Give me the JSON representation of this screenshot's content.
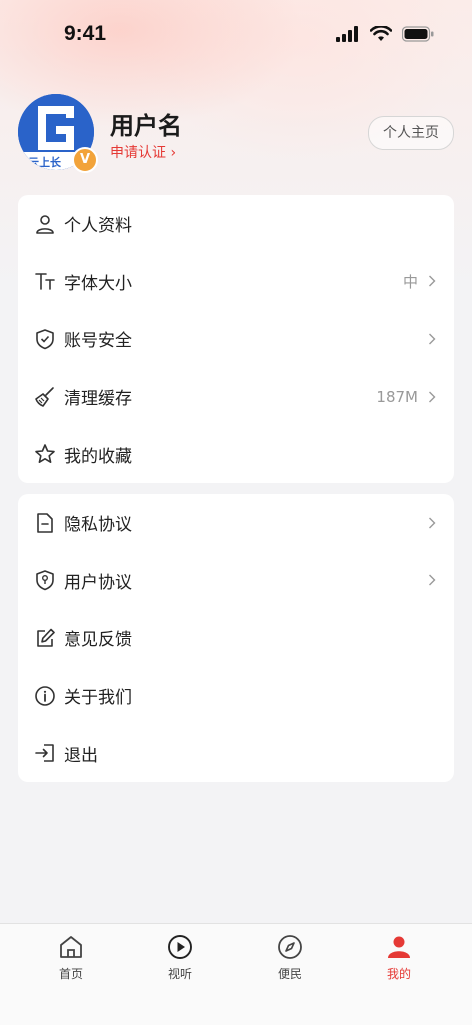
{
  "status": {
    "time": "9:41"
  },
  "profile": {
    "username": "用户名",
    "verify_label": "申请认证 ›",
    "homepage_label": "个人主页",
    "avatar_badge": "V",
    "avatar_logo_text": "云上长"
  },
  "menu_group_1": [
    {
      "label": "个人资料",
      "value": "",
      "icon": "user-icon"
    },
    {
      "label": "字体大小",
      "value": "中",
      "icon": "font-size-icon"
    },
    {
      "label": "账号安全",
      "value": "",
      "icon": "shield-check-icon"
    },
    {
      "label": "清理缓存",
      "value": "187M",
      "icon": "broom-icon"
    },
    {
      "label": "我的收藏",
      "value": "",
      "icon": "star-icon"
    }
  ],
  "menu_group_2": [
    {
      "label": "隐私协议",
      "value": "",
      "icon": "document-icon"
    },
    {
      "label": "用户协议",
      "value": "",
      "icon": "shield-user-icon"
    },
    {
      "label": "意见反馈",
      "value": "",
      "icon": "edit-icon"
    },
    {
      "label": "关于我们",
      "value": "",
      "icon": "info-icon"
    },
    {
      "label": "退出",
      "value": "",
      "icon": "logout-icon"
    }
  ],
  "tabbar": [
    {
      "label": "首页",
      "icon": "home-icon",
      "active": false
    },
    {
      "label": "视听",
      "icon": "play-icon",
      "active": false
    },
    {
      "label": "便民",
      "icon": "compass-icon",
      "active": false
    },
    {
      "label": "我的",
      "icon": "profile-icon",
      "active": true
    }
  ],
  "colors": {
    "accent": "#e53935",
    "avatar_blue": "#2a63c9",
    "badge_orange": "#f2a33a"
  }
}
